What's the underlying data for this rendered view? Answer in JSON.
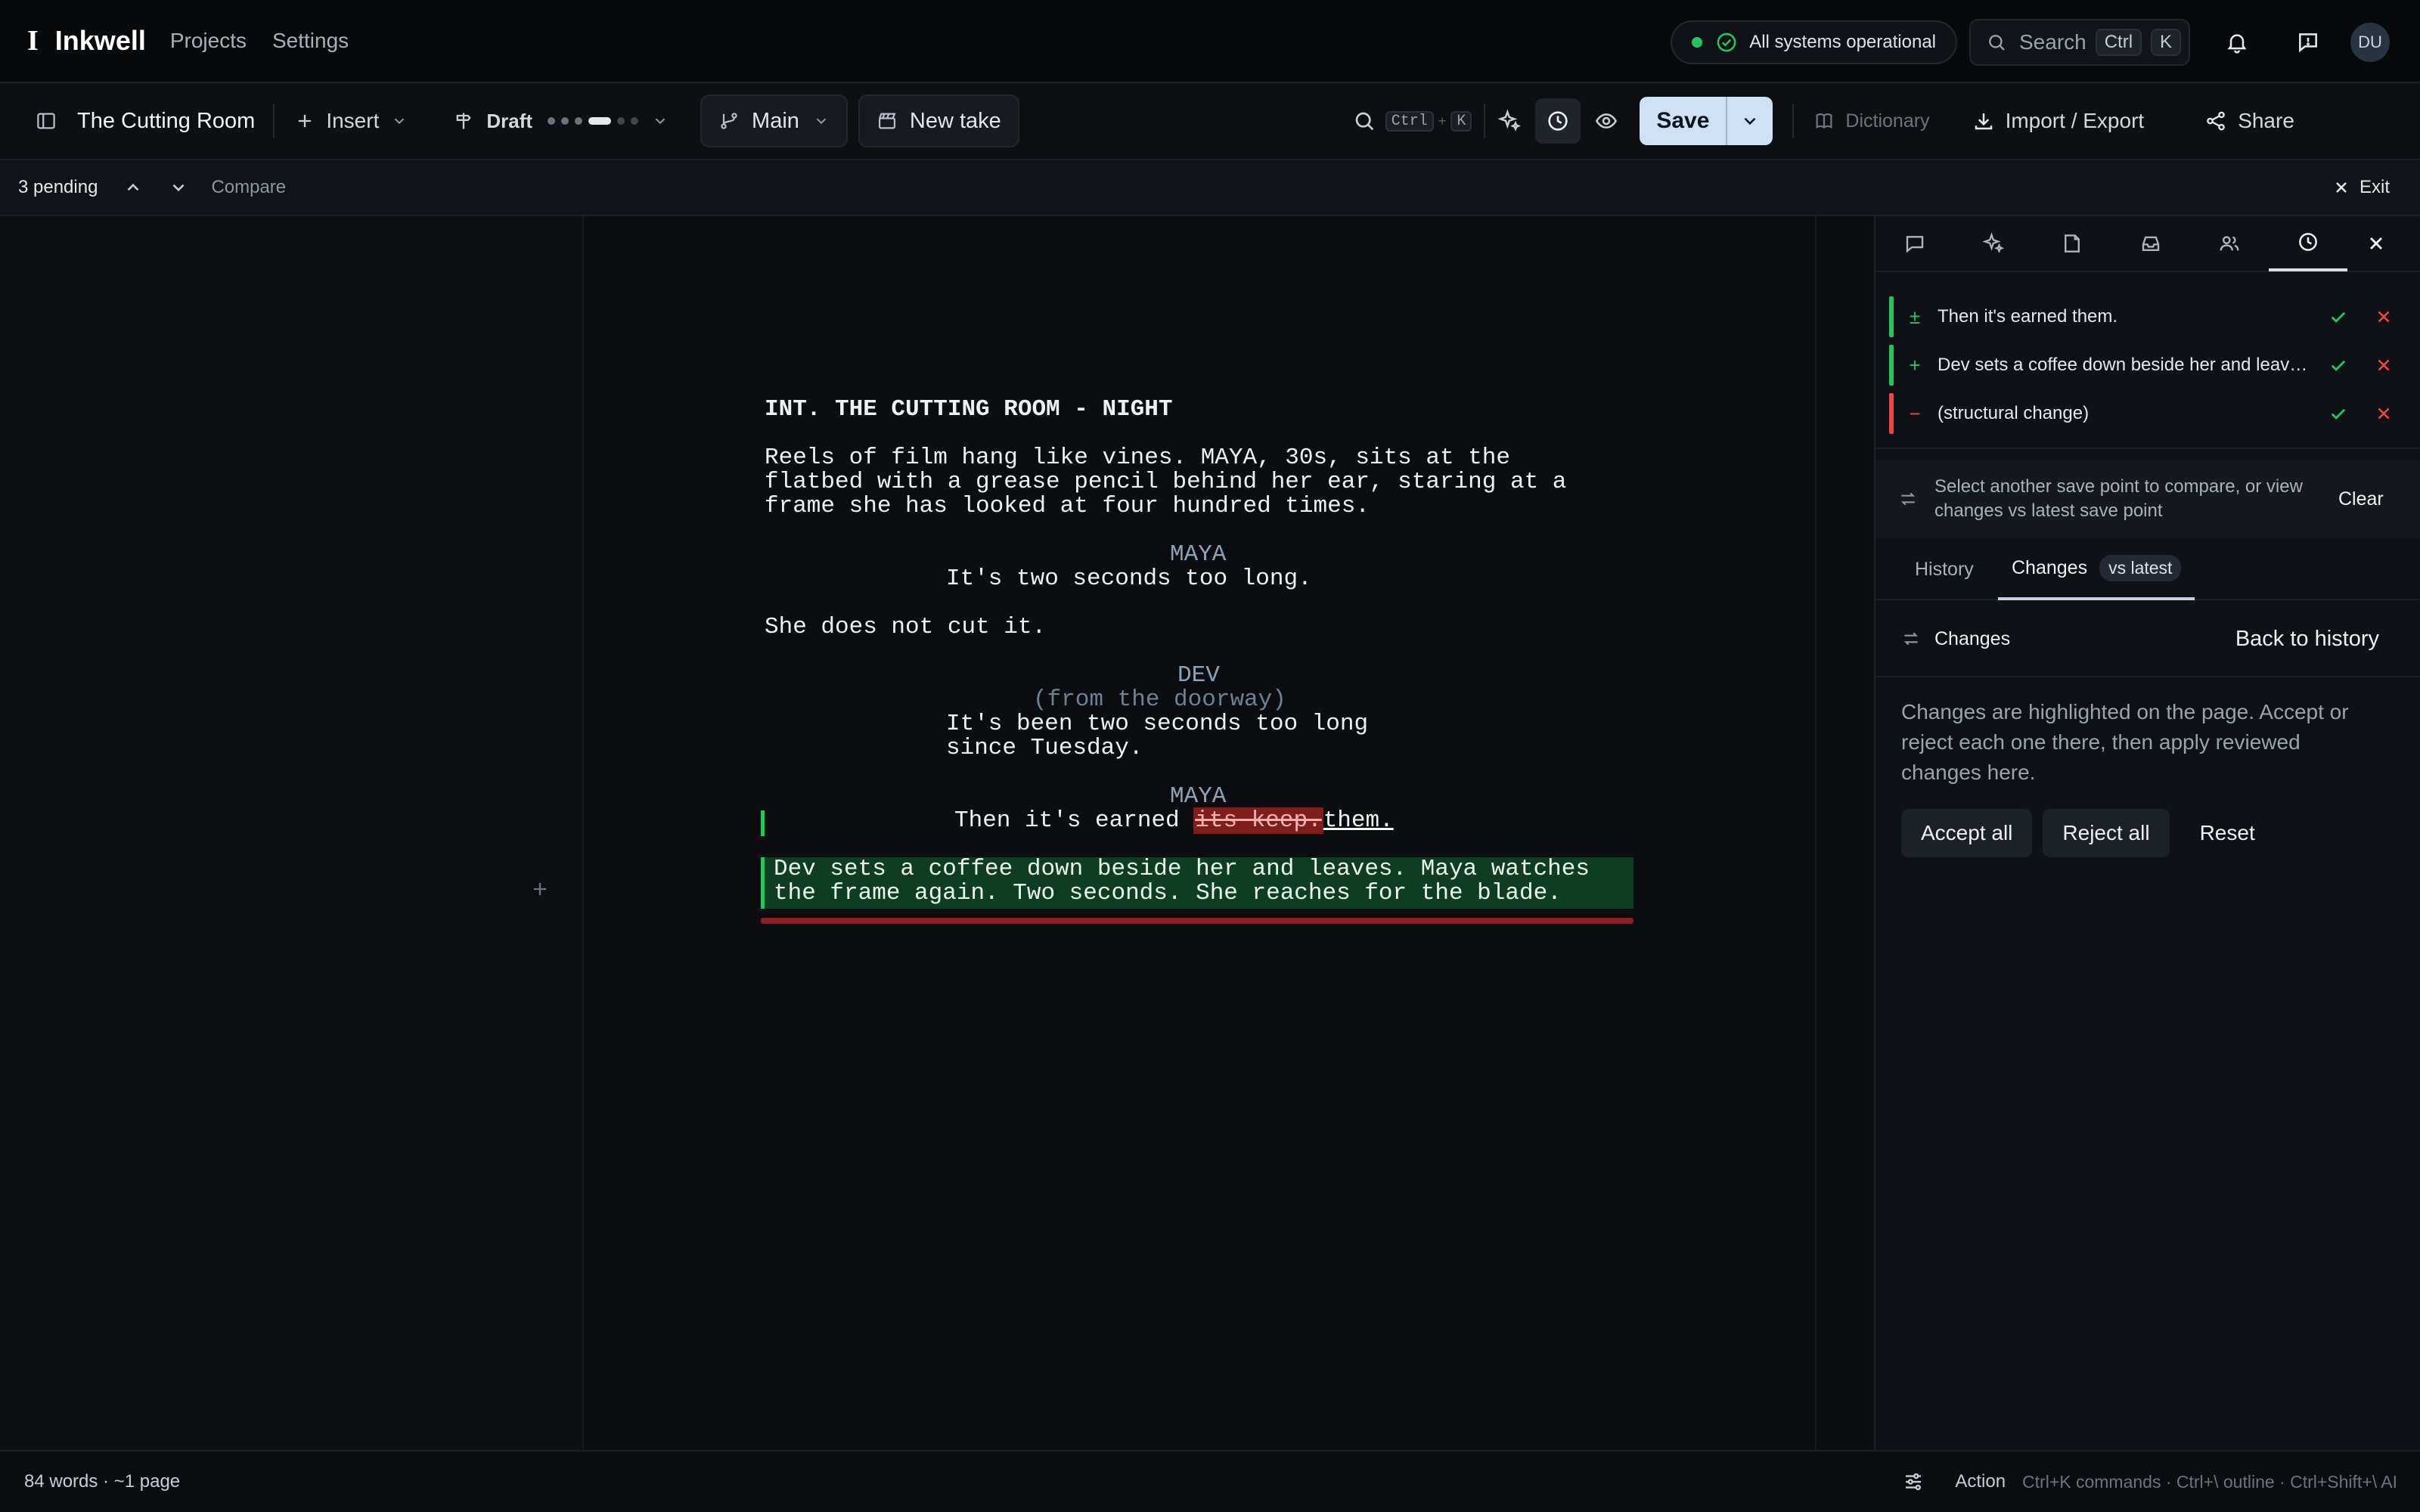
{
  "app": {
    "name": "Inkwell",
    "nav": [
      "Projects",
      "Settings"
    ],
    "status": "All systems operational",
    "search": {
      "label": "Search",
      "key1": "Ctrl",
      "key2": "K"
    },
    "user_initials": "DU"
  },
  "toolbar": {
    "doc_title": "The Cutting Room",
    "insert": "Insert",
    "draft": "Draft",
    "branch": "Main",
    "new_take": "New take",
    "find_key1": "Ctrl",
    "find_plus": "+",
    "find_key2": "K",
    "save": "Save",
    "dictionary": "Dictionary",
    "import_export": "Import / Export",
    "share": "Share"
  },
  "pending_bar": {
    "count": "3 pending",
    "compare": "Compare",
    "exit": "Exit"
  },
  "script": {
    "scene_heading": "INT. THE CUTTING ROOM - NIGHT",
    "action1_line1": "Reels of film hang like vines. MAYA, 30s, sits at the",
    "action1_line2": "flatbed with a grease pencil behind her ear, staring at a",
    "action1_line3": "frame she has looked at four hundred times.",
    "char1": "MAYA",
    "dialogue1": "It's two seconds too long.",
    "action2": "She does not cut it.",
    "char2": "DEV",
    "paren2": "(from the doorway)",
    "dialogue2_line1": "It's been two seconds too long",
    "dialogue2_line2": "since Tuesday.",
    "char3": "MAYA",
    "dialogue3_prefix": "Then it's earned ",
    "dialogue3_deleted": "its keep.",
    "dialogue3_inserted": "them.",
    "action3_line1": "Dev sets a coffee down beside her and leaves. Maya watches",
    "action3_line2": "the frame again. Two seconds. She reaches for the blade."
  },
  "panel": {
    "changes": [
      {
        "symbol": "±",
        "text": "Then it's earned them.",
        "color": "#22c55e"
      },
      {
        "symbol": "+",
        "text": "Dev sets a coffee down beside her and leaves. Maya watches the frame again.",
        "color": "#22c55e"
      },
      {
        "symbol": "−",
        "text": "(structural change)",
        "color": "#ef4444"
      }
    ],
    "compare_hint": "Select another save point to compare, or view changes vs latest save point",
    "clear": "Clear",
    "tab_history": "History",
    "tab_changes": "Changes",
    "tab_badge": "vs latest",
    "section_title": "Changes",
    "back": "Back to history",
    "description": "Changes are highlighted on the page. Accept or reject each one there, then apply reviewed changes here.",
    "accept_all": "Accept all",
    "reject_all": "Reject all",
    "reset": "Reset"
  },
  "statusbar": {
    "stats": "84 words · ~1 page",
    "action": "Action",
    "shortcuts": "Ctrl+K commands · Ctrl+\\ outline · Ctrl+Shift+\\ AI"
  },
  "colors": {
    "accent_green": "#22c55e",
    "accent_red": "#ef4444",
    "save_button": "#cfe2f5"
  }
}
